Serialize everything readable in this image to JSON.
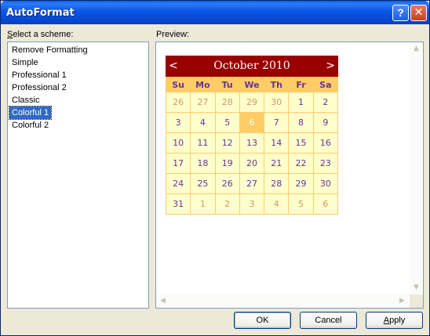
{
  "window": {
    "title": "AutoFormat"
  },
  "titlebar": {
    "help_glyph": "?",
    "close_glyph": "✕"
  },
  "labels": {
    "scheme_prefix": "S",
    "scheme_rest": "elect a scheme:",
    "preview": "Preview:"
  },
  "schemes": [
    {
      "label": "Remove Formatting",
      "selected": false
    },
    {
      "label": "Simple",
      "selected": false
    },
    {
      "label": "Professional 1",
      "selected": false
    },
    {
      "label": "Professional 2",
      "selected": false
    },
    {
      "label": "Classic",
      "selected": false
    },
    {
      "label": "Colorful 1",
      "selected": true
    },
    {
      "label": "Colorful 2",
      "selected": false
    }
  ],
  "calendar": {
    "prev": "<",
    "next": ">",
    "title": "October 2010",
    "weekdays": [
      "Su",
      "Mo",
      "Tu",
      "We",
      "Th",
      "Fr",
      "Sa"
    ],
    "weeks": [
      [
        [
          "26",
          "other"
        ],
        [
          "27",
          "other"
        ],
        [
          "28",
          "other"
        ],
        [
          "29",
          "other"
        ],
        [
          "30",
          "other"
        ],
        [
          "1",
          ""
        ],
        [
          "2",
          ""
        ]
      ],
      [
        [
          "3",
          ""
        ],
        [
          "4",
          ""
        ],
        [
          "5",
          ""
        ],
        [
          "6",
          "today"
        ],
        [
          "7",
          ""
        ],
        [
          "8",
          ""
        ],
        [
          "9",
          ""
        ]
      ],
      [
        [
          "10",
          ""
        ],
        [
          "11",
          ""
        ],
        [
          "12",
          ""
        ],
        [
          "13",
          ""
        ],
        [
          "14",
          ""
        ],
        [
          "15",
          ""
        ],
        [
          "16",
          ""
        ]
      ],
      [
        [
          "17",
          ""
        ],
        [
          "18",
          ""
        ],
        [
          "19",
          ""
        ],
        [
          "20",
          ""
        ],
        [
          "21",
          ""
        ],
        [
          "22",
          ""
        ],
        [
          "23",
          ""
        ]
      ],
      [
        [
          "24",
          ""
        ],
        [
          "25",
          ""
        ],
        [
          "26",
          ""
        ],
        [
          "27",
          ""
        ],
        [
          "28",
          ""
        ],
        [
          "29",
          ""
        ],
        [
          "30",
          ""
        ]
      ],
      [
        [
          "31",
          ""
        ],
        [
          "1",
          "other"
        ],
        [
          "2",
          "other"
        ],
        [
          "3",
          "other"
        ],
        [
          "4",
          "other"
        ],
        [
          "5",
          "other"
        ],
        [
          "6",
          "other"
        ]
      ]
    ],
    "colors": {
      "header_bg": "#990000",
      "weekday_bg": "#ffcc66",
      "day_bg": "#ffffcc",
      "day_text": "#663399",
      "other_month_text": "#cc9966",
      "today_bg": "#ffcc66"
    }
  },
  "buttons": {
    "ok": "OK",
    "cancel": "Cancel",
    "apply_prefix": "A",
    "apply_rest": "pply"
  },
  "colors": {
    "selection": "#316ac5",
    "titlebar": "#0b55e3"
  }
}
